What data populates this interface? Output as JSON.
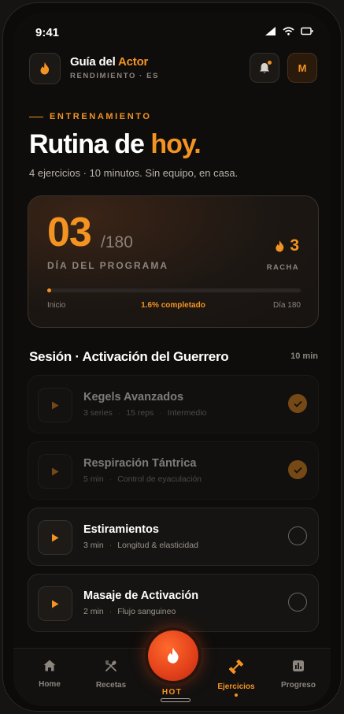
{
  "status": {
    "time": "9:41"
  },
  "header": {
    "title_main": "Guía del ",
    "title_accent": "Actor",
    "subtitle": "RENDIMIENTO · ES",
    "avatar_initial": "M"
  },
  "hero": {
    "eyebrow": "ENTRENAMIENTO",
    "headline_main": "Rutina de ",
    "headline_accent": "hoy.",
    "subline": "4 ejercicios · 10 minutos. Sin equipo, en casa."
  },
  "program": {
    "day": "03",
    "total": "/180",
    "day_label": "DÍA DEL PROGRAMA",
    "streak": "3",
    "streak_label": "RACHA",
    "progress_fraction": 0.016,
    "start_label": "Inicio",
    "progress_label": "1.6% completado",
    "end_label": "Día 180"
  },
  "session": {
    "title": "Sesión · Activación del Guerrero",
    "duration": "10 min"
  },
  "exercises": [
    {
      "name": "Kegels Avanzados",
      "meta": [
        "3 series",
        "15 reps",
        "Intermedio"
      ],
      "done": true
    },
    {
      "name": "Respiración Tántrica",
      "meta": [
        "5 min",
        "Control de eyaculación"
      ],
      "done": true
    },
    {
      "name": "Estiramientos",
      "meta": [
        "3 min",
        "Longitud & elasticidad"
      ],
      "done": false
    },
    {
      "name": "Masaje de Activación",
      "meta": [
        "2 min",
        "Flujo sanguineo"
      ],
      "done": false
    }
  ],
  "tabs": {
    "home": "Home",
    "recetas": "Recetas",
    "hot": "HOT",
    "ejercicios": "Ejercicios",
    "progreso": "Progreso"
  },
  "colors": {
    "accent": "#f39322",
    "hot": "#e2401a"
  }
}
